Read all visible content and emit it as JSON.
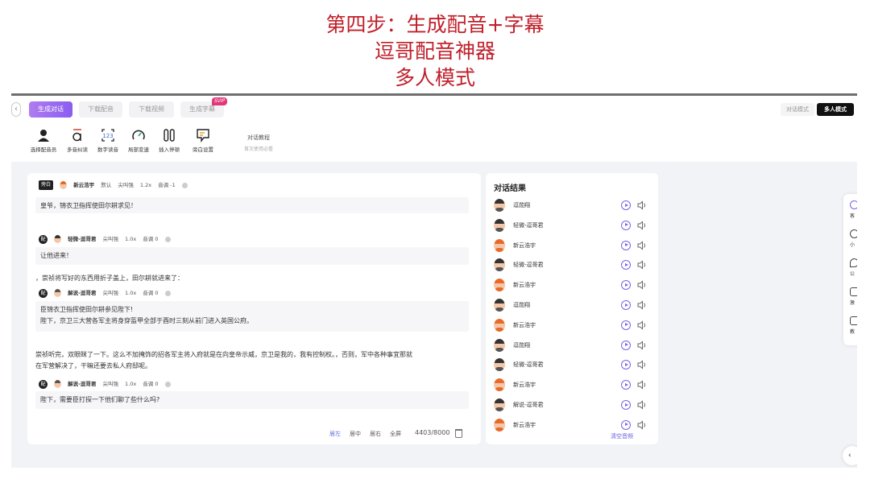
{
  "heading": {
    "line1": "第四步：生成配音+字幕",
    "line2": "逗哥配音神器",
    "line3": "多人模式"
  },
  "topbar": {
    "back": "‹",
    "tabs": [
      {
        "label": "生成对话"
      },
      {
        "label": "下载配音"
      },
      {
        "label": "下载视频"
      },
      {
        "label": "生成字幕"
      }
    ],
    "svip_badge": "SVIP",
    "modes": {
      "dialog": "对话模式",
      "multi": "多人模式"
    }
  },
  "toolbar": {
    "tools": [
      {
        "label": "选择配音员",
        "icon": "person-icon"
      },
      {
        "label": "多音纠读",
        "icon": "pinyin-icon"
      },
      {
        "label": "数字读音",
        "icon": "number-icon"
      },
      {
        "label": "局部变速",
        "icon": "speed-gauge-icon"
      },
      {
        "label": "插入停顿",
        "icon": "pause-icon"
      },
      {
        "label": "旁白设置",
        "icon": "narration-icon"
      }
    ],
    "tutorial": {
      "title": "对话教程",
      "subtitle": "首次使用必看"
    }
  },
  "editor": {
    "blocks": [
      {
        "role": "旁白",
        "speaker": "新云浩宇",
        "emotion": "默认",
        "style": "尖叫强",
        "speed": "1.2x",
        "pitch": "音调 -1",
        "text": "皇爷，锦衣卫指挥使田尔耕求见！"
      },
      {
        "role": "配",
        "speaker": "轻微-逗哥君",
        "style": "尖叫强",
        "speed": "1.0x",
        "pitch": "音调 0",
        "text": "让他进来！"
      },
      {
        "narration": "，崇祯将写好的东西用折子盖上，田尔耕就进来了："
      },
      {
        "role": "配",
        "speaker": "解说-逗哥君",
        "style": "尖叫强",
        "speed": "1.0x",
        "pitch": "音调 0",
        "text_line1": "臣锦衣卫指挥使田尔耕参见陛下!",
        "text_line2": "陛下，京卫三大营各军主将身穿盔甲全部于酉时三刻从前门进入英国公府。"
      },
      {
        "narration_line1": "崇祯听完，双眼眯了一下。这么不加掩饰的招各军主将入府就是在向皇帝示威，京卫是我的，我有控制权。，否则，军中各种事宜那就",
        "narration_line2": "在军营解决了，干嘛还要去私人府邸呢。"
      },
      {
        "role": "配",
        "speaker": "解说-逗哥君",
        "style": "尖叫强",
        "speed": "1.0x",
        "pitch": "音调 0",
        "text": "陛下，需要臣打探一下他们聊了些什么吗?"
      }
    ],
    "footer": {
      "align_left": "居左",
      "align_center": "居中",
      "align_right": "居右",
      "fullscreen": "全屏",
      "count": "4403/8000"
    }
  },
  "results": {
    "title": "对话结果",
    "rows": [
      {
        "name": "逗勋翔"
      },
      {
        "name": "轻微-逗哥君"
      },
      {
        "name": "新云浩宇"
      },
      {
        "name": "轻微-逗哥君"
      },
      {
        "name": "新云浩宇"
      },
      {
        "name": "逗勋翔"
      },
      {
        "name": "新云浩宇"
      },
      {
        "name": "逗勋翔"
      },
      {
        "name": "轻微-逗哥君"
      },
      {
        "name": "新云浩宇"
      },
      {
        "name": "解说-逗哥君"
      },
      {
        "name": "新云浩宇"
      }
    ],
    "clear": "清空音频"
  },
  "side": {
    "items": [
      {
        "label": "客"
      },
      {
        "label": "小"
      },
      {
        "label": "公"
      },
      {
        "label": "激"
      },
      {
        "label": "教"
      }
    ],
    "collapse": "‹"
  },
  "colors": {
    "heading": "#c0202a",
    "accent": "#8a5df0",
    "link": "#6a5ae0"
  }
}
